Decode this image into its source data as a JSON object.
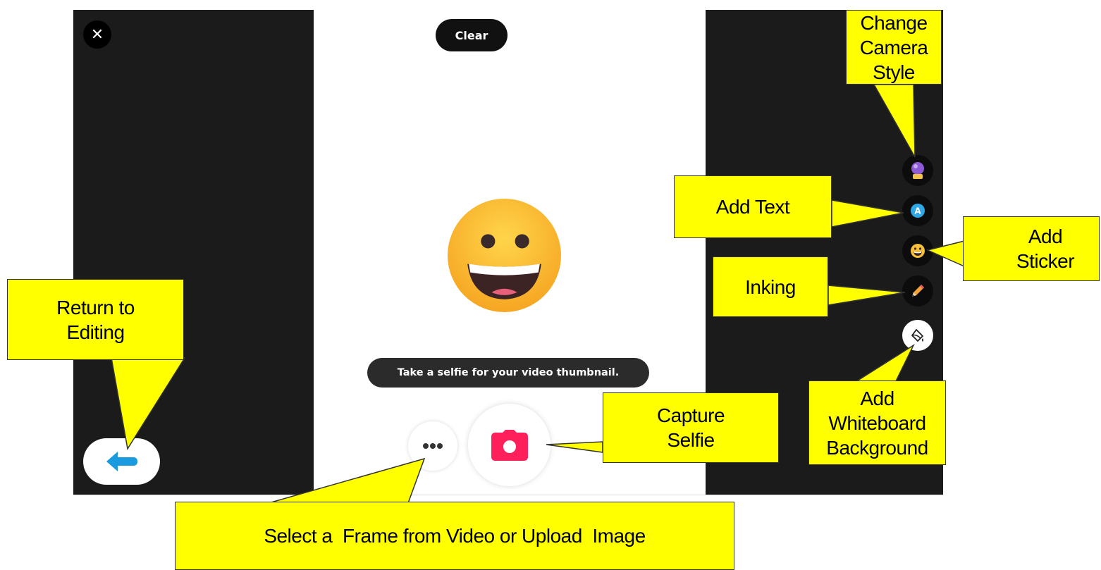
{
  "top_bar": {
    "clear_label": "Clear"
  },
  "tooltip": {
    "text": "Take a selfie for your video thumbnail."
  },
  "sidebar_tools": [
    {
      "name": "camera-style",
      "icon": "crystal-ball-icon"
    },
    {
      "name": "add-text",
      "icon": "letter-a-icon"
    },
    {
      "name": "add-sticker",
      "icon": "smiley-icon"
    },
    {
      "name": "inking",
      "icon": "pencil-icon"
    },
    {
      "name": "whiteboard-background",
      "icon": "paint-bucket-icon"
    }
  ],
  "callouts": {
    "camera_style": "Change Camera Style",
    "add_text": "Add Text",
    "add_sticker": "Add Sticker",
    "inking": "Inking",
    "whiteboard": "Add Whiteboard Background",
    "capture_selfie": "Capture Selfie",
    "return_editing": "Return to Editing",
    "select_frame": "Select a  Frame from Video or Upload  Image"
  },
  "colors": {
    "panel": "#1b1b1b",
    "callout": "#ffff00",
    "capture": "#ff1f5a",
    "back_arrow": "#1a9be0"
  }
}
